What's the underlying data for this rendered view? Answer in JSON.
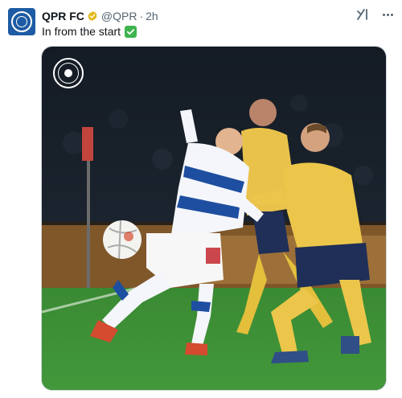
{
  "account": {
    "name": "QPR FC",
    "handle": "@QPR",
    "separator": "·",
    "time": "2h"
  },
  "tweet": {
    "text": "In from the start",
    "emoji_icon": "white-check-mark-icon"
  },
  "icons": {
    "avatar": "qpr-crest-avatar",
    "verified": "verified-badge-icon",
    "grok": "grok-icon",
    "more": "more-options-icon",
    "watermark": "qpr-crest-watermark"
  },
  "colors": {
    "verified_badge": "#e2b719",
    "check_emoji": "#3eb34f",
    "qpr_blue": "#1d5ba4",
    "pitch_green": "#3f8d37",
    "opponent_kit": "#f0c845"
  }
}
